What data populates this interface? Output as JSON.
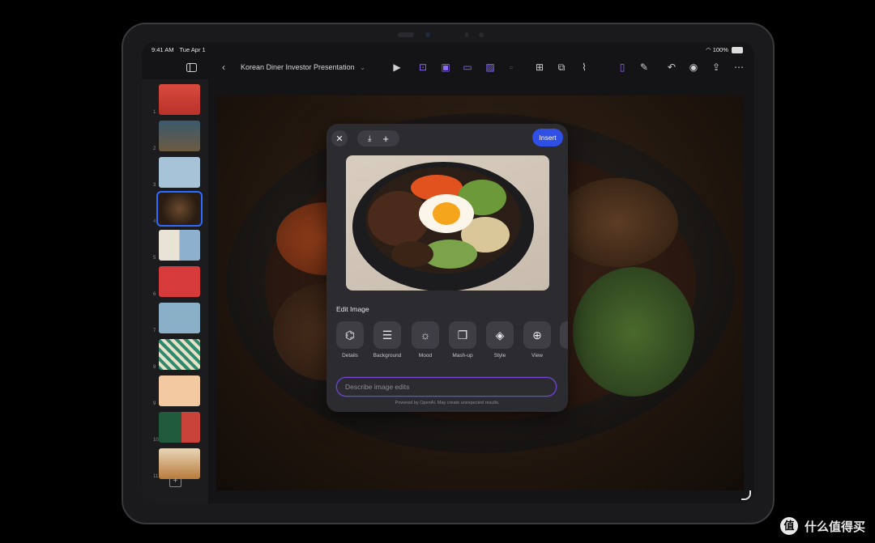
{
  "status_bar": {
    "time": "9:41 AM",
    "date": "Tue Apr 1",
    "wifi_icon": "wifi-icon",
    "battery": "100%"
  },
  "toolbar": {
    "doc_title": "Korean Diner Investor Presentation",
    "accent_color": "#8e6cff",
    "icons": [
      "sidebar-icon",
      "back-icon",
      "play-icon",
      "text-box-icon",
      "image-gen-icon",
      "media-icon",
      "photo-icon",
      "table-icon",
      "shapes-icon",
      "attach-icon",
      "doc-icon",
      "pen-icon",
      "undo-icon",
      "collaborate-icon",
      "share-icon",
      "more-icon"
    ]
  },
  "slides": {
    "numbers": [
      "1",
      "2",
      "3",
      "4",
      "5",
      "6",
      "7",
      "8",
      "9",
      "10",
      "11"
    ],
    "selected": "4",
    "add_icon": "add-slide-icon"
  },
  "dialog": {
    "insert_label": "Insert",
    "section_title": "Edit Image",
    "options": [
      {
        "label": "Details",
        "icon": "details-icon",
        "glyph": "⌬"
      },
      {
        "label": "Background",
        "icon": "background-icon",
        "glyph": "☰"
      },
      {
        "label": "Mood",
        "icon": "mood-icon",
        "glyph": "☼"
      },
      {
        "label": "Mash-up",
        "icon": "mashup-icon",
        "glyph": "❐"
      },
      {
        "label": "Style",
        "icon": "style-icon",
        "glyph": "◈"
      },
      {
        "label": "View",
        "icon": "view-icon",
        "glyph": "⊕"
      }
    ],
    "prompt_placeholder": "Describe image edits",
    "footnote": "Powered by OpenAI. May create unexpected results.",
    "prompt_border_color": "#7a45d8",
    "insert_color": "#2f4fe6"
  },
  "watermark": {
    "logo_glyph": "值",
    "text": "什么值得买"
  }
}
